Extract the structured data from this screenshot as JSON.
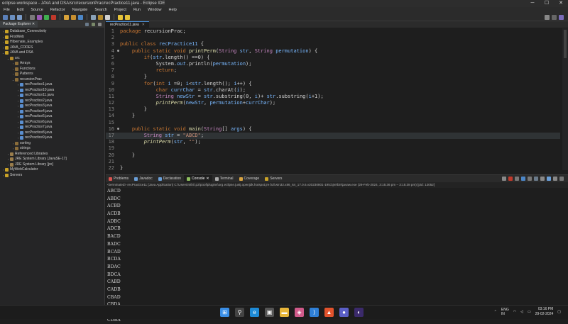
{
  "window": {
    "title": "eclipse-workspace - JAVA and DSA/src/recursionPrac/recPractice11.java - Eclipse IDE",
    "controls": [
      "─",
      "☐",
      "✕"
    ]
  },
  "menu": [
    "File",
    "Edit",
    "Source",
    "Refactor",
    "Navigate",
    "Search",
    "Project",
    "Run",
    "Window",
    "Help"
  ],
  "package_explorer": {
    "tab_label": "Package Explorer",
    "tab_close": "✕",
    "items": [
      {
        "label": "Database_Connectivity",
        "indent": 0,
        "arrow": "›",
        "icon": "project-icon",
        "color": "#c9a227"
      },
      {
        "label": "FirstWeb",
        "indent": 0,
        "arrow": "›",
        "icon": "project-icon",
        "color": "#c9a227"
      },
      {
        "label": "Hibernate_Examples",
        "indent": 0,
        "arrow": "›",
        "icon": "project-icon",
        "color": "#c9a227"
      },
      {
        "label": "JAVA_CODES",
        "indent": 0,
        "arrow": "›",
        "icon": "project-icon",
        "color": "#c9a227"
      },
      {
        "label": "JAVA and DSA",
        "indent": 0,
        "arrow": "⌄",
        "icon": "project-icon",
        "color": "#c9a227"
      },
      {
        "label": "src",
        "indent": 1,
        "arrow": "⌄",
        "icon": "source-folder-icon",
        "color": "#b58b2b"
      },
      {
        "label": "Arrays",
        "indent": 2,
        "arrow": "›",
        "icon": "package-icon",
        "color": "#8b6d3a"
      },
      {
        "label": "Functions",
        "indent": 2,
        "arrow": "›",
        "icon": "package-icon",
        "color": "#8b6d3a"
      },
      {
        "label": "Patterns",
        "indent": 2,
        "arrow": "›",
        "icon": "package-icon",
        "color": "#8b6d3a"
      },
      {
        "label": "recursionPrac",
        "indent": 2,
        "arrow": "⌄",
        "icon": "package-icon",
        "color": "#8b6d3a"
      },
      {
        "label": "recPractice1.java",
        "indent": 3,
        "arrow": "›",
        "icon": "java-file-icon",
        "color": "#5b8fd0"
      },
      {
        "label": "recPractice10.java",
        "indent": 3,
        "arrow": "›",
        "icon": "java-file-icon",
        "color": "#5b8fd0"
      },
      {
        "label": "recPractice11.java",
        "indent": 3,
        "arrow": "›",
        "icon": "java-file-icon",
        "color": "#5b8fd0"
      },
      {
        "label": "recPractice2.java",
        "indent": 3,
        "arrow": "›",
        "icon": "java-file-icon",
        "color": "#5b8fd0"
      },
      {
        "label": "recPractice3.java",
        "indent": 3,
        "arrow": "›",
        "icon": "java-file-icon",
        "color": "#5b8fd0"
      },
      {
        "label": "recPractice4.java",
        "indent": 3,
        "arrow": "›",
        "icon": "java-file-icon",
        "color": "#5b8fd0"
      },
      {
        "label": "recPractice5.java",
        "indent": 3,
        "arrow": "›",
        "icon": "java-file-icon",
        "color": "#5b8fd0"
      },
      {
        "label": "recPractice6.java",
        "indent": 3,
        "arrow": "›",
        "icon": "java-file-icon",
        "color": "#5b8fd0"
      },
      {
        "label": "recPractice7.java",
        "indent": 3,
        "arrow": "›",
        "icon": "java-file-icon",
        "color": "#5b8fd0"
      },
      {
        "label": "recPractice8.java",
        "indent": 3,
        "arrow": "›",
        "icon": "java-file-icon",
        "color": "#5b8fd0"
      },
      {
        "label": "recPractice9.java",
        "indent": 3,
        "arrow": "›",
        "icon": "java-file-icon",
        "color": "#5b8fd0"
      },
      {
        "label": "sorting",
        "indent": 2,
        "arrow": "›",
        "icon": "package-icon",
        "color": "#8b6d3a"
      },
      {
        "label": "strings",
        "indent": 2,
        "arrow": "›",
        "icon": "package-icon",
        "color": "#8b6d3a"
      },
      {
        "label": "Referenced Libraries",
        "indent": 1,
        "arrow": "›",
        "icon": "library-icon",
        "color": "#9a7d4c"
      },
      {
        "label": "JRE System Library [JavaSE-17]",
        "indent": 1,
        "arrow": "›",
        "icon": "library-icon",
        "color": "#9a7d4c"
      },
      {
        "label": "JRE System Library [jre]",
        "indent": 1,
        "arrow": "›",
        "icon": "library-icon",
        "color": "#9a7d4c"
      },
      {
        "label": "MyWebCalculator",
        "indent": 0,
        "arrow": "›",
        "icon": "project-icon",
        "color": "#c9a227"
      },
      {
        "label": "Servers",
        "indent": 0,
        "arrow": "›",
        "icon": "folder-icon",
        "color": "#c9a227"
      }
    ]
  },
  "editor": {
    "tab_label": "recPractice11.java",
    "tab_close": "✕",
    "lines": [
      {
        "n": "1",
        "mark": "",
        "html": "<span class='kw'>package</span> recursionPrac;"
      },
      {
        "n": "2",
        "mark": "",
        "html": ""
      },
      {
        "n": "3",
        "mark": "",
        "html": "<span class='kw'>public class</span> <span class='id'>recPractice11</span> {"
      },
      {
        "n": "4",
        "mark": "●",
        "html": "    <span class='kw'>public static void</span> <span class='fn'>printPerm</span>(<span class='ty'>String</span> <span class='id'>str</span>, <span class='ty'>String</span> <span class='id'>permutation</span>) {"
      },
      {
        "n": "5",
        "mark": "",
        "html": "        <span class='kw'>if</span>(<span class='id'>str</span>.length() ==<span class='cm'>0</span>) {"
      },
      {
        "n": "6",
        "mark": "",
        "html": "            System.<span class='id it'>out</span>.println(<span class='id'>permutation</span>);"
      },
      {
        "n": "7",
        "mark": "",
        "html": "            <span class='kw'>return</span>;"
      },
      {
        "n": "8",
        "mark": "",
        "html": "        }"
      },
      {
        "n": "9",
        "mark": "",
        "html": "        <span class='kw'>for</span>(<span class='kw'>int</span> <span class='id'>i</span> =<span class='cm'>0</span>; <span class='id'>i</span>&lt;<span class='id'>str</span>.length(); <span class='id'>i</span>++) {"
      },
      {
        "n": "10",
        "mark": "",
        "html": "            <span class='kw'>char</span> <span class='id'>currChar</span> = <span class='id'>str</span>.charAt(<span class='id'>i</span>);"
      },
      {
        "n": "11",
        "mark": "",
        "html": "            <span class='ty'>String</span> <span class='id'>newStr</span> = <span class='id'>str</span>.substring(<span class='cm'>0</span>, <span class='id'>i</span>)+ <span class='id'>str</span>.substring(<span class='id'>i</span>+<span class='cm'>1</span>);"
      },
      {
        "n": "12",
        "mark": "",
        "html": "            <span class='fn it'>printPerm</span>(<span class='id'>newStr</span>, <span class='id'>permutation</span>+<span class='id'>currChar</span>);"
      },
      {
        "n": "13",
        "mark": "",
        "html": "        }"
      },
      {
        "n": "14",
        "mark": "",
        "html": "    }"
      },
      {
        "n": "15",
        "mark": "",
        "html": ""
      },
      {
        "n": "16",
        "mark": "●",
        "html": "    <span class='kw'>public static void</span> <span class='fn'>main</span>(<span class='ty'>String</span>[] <span class='id'>args</span>) {"
      },
      {
        "n": "17",
        "mark": "",
        "html": "        <span class='ty'>String</span> <span class='id'>str</span> = <span class='st'>\"ABCD\"</span>;",
        "highlight": true
      },
      {
        "n": "18",
        "mark": "",
        "html": "        <span class='fn it'>printPerm</span>(<span class='id'>str</span>, <span class='st'>\"\"</span>);"
      },
      {
        "n": "19",
        "mark": "",
        "html": ""
      },
      {
        "n": "20",
        "mark": "",
        "html": "    }"
      },
      {
        "n": "21",
        "mark": "",
        "html": ""
      },
      {
        "n": "22",
        "mark": "",
        "html": "}"
      }
    ]
  },
  "console": {
    "tabs": [
      {
        "label": "Problems",
        "icon": "problems-icon",
        "color": "#d9534f"
      },
      {
        "label": "Javadoc",
        "icon": "javadoc-icon",
        "color": "#6a9fd8"
      },
      {
        "label": "Declaration",
        "icon": "declaration-icon",
        "color": "#6a9fd8"
      },
      {
        "label": "Console",
        "icon": "console-icon",
        "color": "#8fbf5f",
        "active": true
      },
      {
        "label": "Terminal",
        "icon": "terminal-icon",
        "color": "#aaaaaa"
      },
      {
        "label": "Coverage",
        "icon": "coverage-icon",
        "color": "#d9a441"
      },
      {
        "label": "Servers",
        "icon": "servers-icon",
        "color": "#c9a227"
      }
    ],
    "close_glyph": "✕",
    "status": "<terminated> recPractice11 [Java Application] C:\\Users\\nithi\\.p2\\pool\\plugins\\org.eclipse.justj.openjdk.hotspot.jre.full.win32.x86_64_17.0.6.v20230801-1951\\jre\\bin\\javaw.exe (29-Feb-2024, 3:15:36 pm – 3:15:38 pm) [pid: 12052]",
    "output": [
      "ABCD",
      "ABDC",
      "ACBD",
      "ACDB",
      "ADBC",
      "ADCB",
      "BACD",
      "BADC",
      "BCAD",
      "BCDA",
      "BDAC",
      "BDCA",
      "CABD",
      "CADB",
      "CBAD",
      "CBDA",
      "CDAB",
      "CDBA"
    ]
  },
  "taskbar": {
    "apps": [
      {
        "name": "windows-start-icon",
        "glyph": "⊞",
        "color": "#3a8ee6"
      },
      {
        "name": "search-icon",
        "glyph": "⚲",
        "color": "#444"
      },
      {
        "name": "edge-icon",
        "glyph": "e",
        "color": "#1e8ad6"
      },
      {
        "name": "store-icon",
        "glyph": "▣",
        "color": "#555"
      },
      {
        "name": "file-explorer-icon",
        "glyph": "▬",
        "color": "#e8b63a"
      },
      {
        "name": "photos-icon",
        "glyph": "◈",
        "color": "#d05a8a"
      },
      {
        "name": "vscode-icon",
        "glyph": "⟩",
        "color": "#2f7fd6"
      },
      {
        "name": "brave-icon",
        "glyph": "▲",
        "color": "#e2532d"
      },
      {
        "name": "teams-icon",
        "glyph": "●",
        "color": "#5b5fc7"
      },
      {
        "name": "eclipse-icon",
        "glyph": "◐",
        "color": "#3b2a6b"
      }
    ],
    "tray": {
      "lang": "ENG\nIN",
      "time": "03:16 PM",
      "date": "29-02-2024"
    }
  }
}
